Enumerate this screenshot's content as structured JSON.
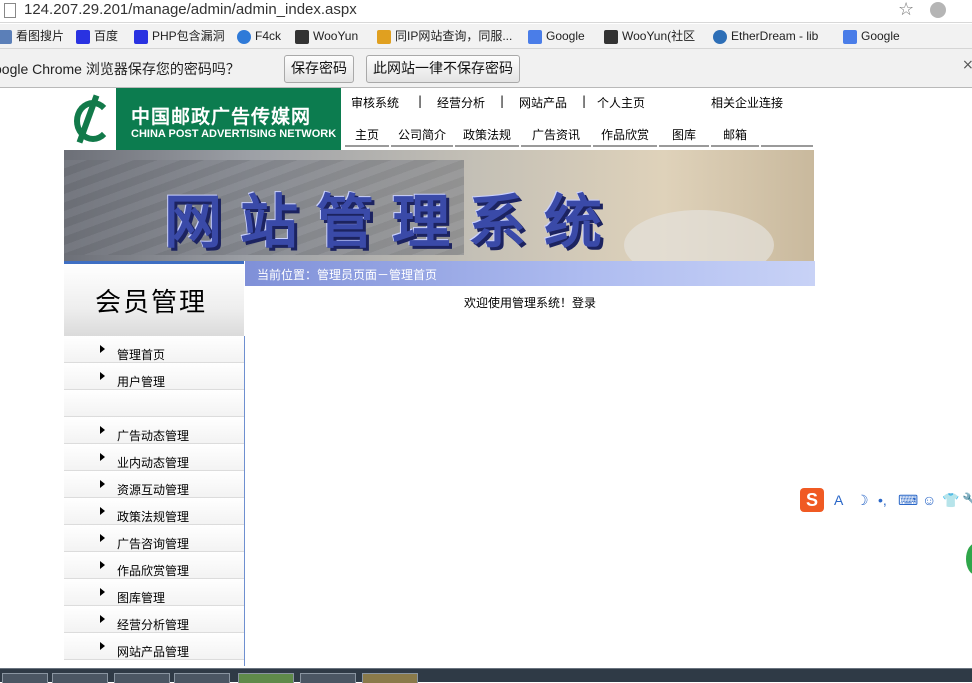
{
  "browser": {
    "url": "124.207.29.201/manage/admin/admin_index.aspx",
    "bookmarks": [
      {
        "label": "看图搜片",
        "icon": "camera-icon",
        "color": "#5b7fb8"
      },
      {
        "label": "百度",
        "icon": "baidu-paw-icon",
        "color": "#2932e1"
      },
      {
        "label": "PHP包含漏洞",
        "icon": "baidu-paw-icon",
        "color": "#2932e1"
      },
      {
        "label": "F4ck",
        "icon": "refresh-icon",
        "color": "#2f7ad8"
      },
      {
        "label": "WooYun",
        "icon": "wooyun-icon",
        "color": "#333333"
      },
      {
        "label": "同IP网站查询，同服...",
        "icon": "site-query-icon",
        "color": "#e0a020"
      },
      {
        "label": "Google",
        "icon": "google-icon",
        "color": "#4a7de8"
      },
      {
        "label": "WooYun(社区",
        "icon": "wooyun-icon",
        "color": "#333333"
      },
      {
        "label": "EtherDream - lib",
        "icon": "ether-icon",
        "color": "#2e6fb7"
      },
      {
        "label": "Google",
        "icon": "google-icon",
        "color": "#4a7de8"
      }
    ],
    "password_bar": {
      "message": "oogle Chrome 浏览器保存您的密码吗？",
      "save_label": "保存密码",
      "never_label": "此网站一律不保存密码"
    }
  },
  "site": {
    "logo_cn": "中国邮政广告传媒网",
    "logo_en": "CHINA POST ADVERTISING NETWORK",
    "top_links": [
      "审核系统",
      "|",
      "经营分析",
      "|",
      "网站产品",
      "|",
      "个人主页",
      "相关企业连接"
    ],
    "main_nav": [
      "主页",
      "公司简介",
      "政策法规",
      "广告资讯",
      "作品欣赏",
      "图库",
      "邮箱"
    ],
    "banner_title": "网站管理系统"
  },
  "sidebar": {
    "title": "会员管理",
    "items": [
      {
        "label": "管理首页"
      },
      {
        "label": "用户管理"
      },
      {
        "label": ""
      },
      {
        "label": "广告动态管理"
      },
      {
        "label": "业内动态管理"
      },
      {
        "label": "资源互动管理"
      },
      {
        "label": "政策法规管理"
      },
      {
        "label": "广告咨询管理"
      },
      {
        "label": "作品欣赏管理"
      },
      {
        "label": "图库管理"
      },
      {
        "label": "经营分析管理"
      },
      {
        "label": "网站产品管理"
      }
    ]
  },
  "main": {
    "breadcrumb": "当前位置：管理员页面－管理首页",
    "welcome": "欢迎使用管理系统！登录"
  },
  "ime_toolbar": {
    "logo": "S",
    "icons": [
      "A",
      "☽",
      "•,",
      "⌨",
      "☺",
      "👕",
      "🔧"
    ]
  },
  "colors": {
    "logo_green": "#0c7c4f",
    "breadcrumb_blue": "#7f90d8",
    "sidebar_accent": "#3f6fc3"
  }
}
